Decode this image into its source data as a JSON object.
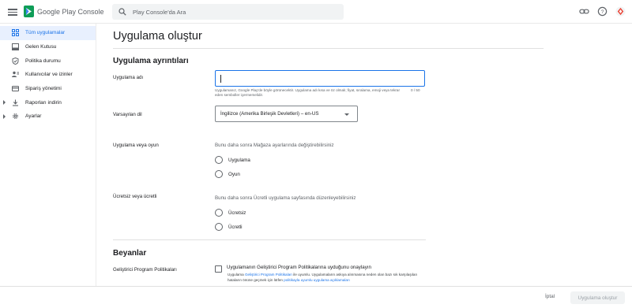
{
  "app": {
    "logo_text": "Google Play Console"
  },
  "search": {
    "placeholder": "Play Console'da Ara"
  },
  "topbar_icons": [
    "link-icon",
    "help-icon",
    "account-icon"
  ],
  "sidebar": {
    "items": [
      {
        "label": "Tüm uygulamalar",
        "icon": "apps-grid-icon",
        "active": true
      },
      {
        "label": "Gelen Kutusu",
        "icon": "inbox-icon"
      },
      {
        "label": "Politika durumu",
        "icon": "shield-icon"
      },
      {
        "label": "Kullanıcılar ve izinler",
        "icon": "users-icon"
      },
      {
        "label": "Sipariş yönetimi",
        "icon": "credit-card-icon"
      },
      {
        "label": "Raporları indirin",
        "icon": "download-icon",
        "expandable": true
      },
      {
        "label": "Ayarlar",
        "icon": "gear-icon",
        "expandable": true
      }
    ]
  },
  "main": {
    "title": "Uygulama oluştur",
    "details_section": "Uygulama ayrıntıları",
    "app_name": {
      "label": "Uygulama adı",
      "value": "",
      "help": "Uygulamanız, Google Play'de böyle görünecektir. Uygulama adı kısa ve öz olmalı; fiyat, sıralama, emoji veya tekrar eden semboller içermemelidir.",
      "counter": "0 / 50"
    },
    "default_language": {
      "label": "Varsayılan dil",
      "value": "İngilizce (Amerika Birleşik Devletleri) – en-US"
    },
    "app_or_game": {
      "label": "Uygulama veya oyun",
      "hint": "Bunu daha sonra Mağaza ayarlarında değiştirebilirsiniz",
      "options": [
        "Uygulama",
        "Oyun"
      ]
    },
    "free_or_paid": {
      "label": "Ücretsiz veya ücretli",
      "hint": "Bunu daha sonra Ücretli uygulama sayfasında düzenleyebilirsiniz",
      "options": [
        "Ücretsiz",
        "Ücretli"
      ]
    },
    "declarations_section": "Beyanlar",
    "developer_policies": {
      "label": "Geliştirici Program Politikaları",
      "checkbox_label": "Uygulamanın Geliştirici Program Politikalarına uyduğunu onaylayın",
      "text_before_link": "Uygulama ",
      "link1": "Geliştirici Program Politikaları",
      "text_middle": " ile uyumlu. Uygulamaların askıya alınmasına neden olan bazı sık karşılaşılan hataların önüne geçmek için lütfen ",
      "link2": "politikayla uyumlu uygulama açıklamaları"
    }
  },
  "footer": {
    "cancel_label": "İptal",
    "create_label": "Uygulama oluştur"
  },
  "colors": {
    "accent": "#1a73e8",
    "active_bg": "#e8f0fe"
  }
}
